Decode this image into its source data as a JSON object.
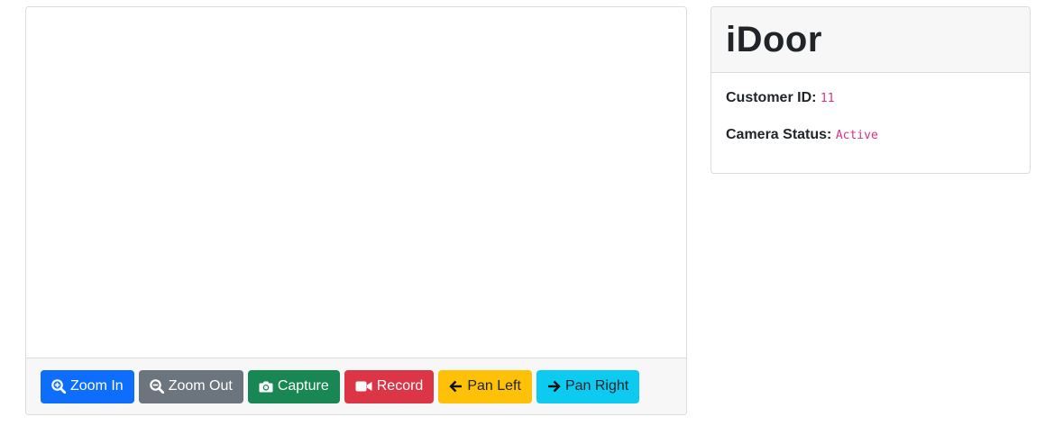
{
  "controls": {
    "zoom_in": "Zoom In",
    "zoom_out": "Zoom Out",
    "capture": "Capture",
    "record": "Record",
    "pan_left": "Pan Left",
    "pan_right": "Pan Right"
  },
  "icons": {
    "zoom_in": "zoom-in-icon",
    "zoom_out": "zoom-out-icon",
    "capture": "camera-icon",
    "record": "video-camera-icon",
    "pan_left": "arrow-left-icon",
    "pan_right": "arrow-right-icon"
  },
  "info": {
    "title": "iDoor",
    "customer_id_label": "Customer ID:",
    "customer_id_value": "11",
    "camera_status_label": "Camera Status:",
    "camera_status_value": "Active"
  },
  "colors": {
    "primary": "#0d6efd",
    "secondary": "#6c757d",
    "success": "#198754",
    "danger": "#dc3545",
    "warning": "#ffc107",
    "info": "#0dcaf0",
    "code": "#d63384"
  }
}
